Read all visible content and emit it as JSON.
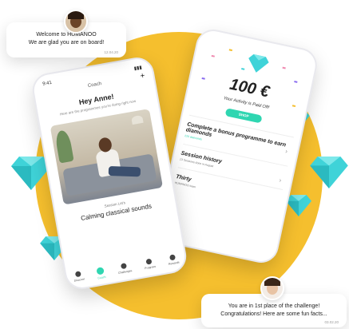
{
  "bubble_top": {
    "title": "Welcome to HUMANOO",
    "text": "We are glad you are on board!",
    "date": "12.04.20"
  },
  "bubble_bottom": {
    "title": "You are in 1st place of the challenge!",
    "text": "Congratulations! Here are some fun facts...",
    "date": "03.02.20"
  },
  "phone_left": {
    "status_time": "9:41",
    "header_title": "Coach",
    "add_label": "+",
    "greeting": "Hey Anne!",
    "subtitle": "Here are the programmes you're doing right now",
    "session_label": "Session Let's",
    "session_title": "Calming classical sounds",
    "nav": [
      "Discover",
      "Coach",
      "Challenges",
      "Progress",
      "Rewards"
    ]
  },
  "phone_right": {
    "amount": "100 €",
    "paid_text": "Your Activity is Paid Off!",
    "shop_label": "SHOP",
    "cards": [
      {
        "title": "Complete a bonus programme to earn diamonds",
        "sub": "220 diamonds"
      },
      {
        "title": "Session history",
        "sub": "13 Sessions done in August"
      },
      {
        "title": "Thirty",
        "sub": "HUMANOO team"
      }
    ]
  },
  "colors": {
    "accent": "#2fd6b1",
    "circle": "#f5bf2e",
    "diamond": "#3fd3d8"
  },
  "icons": [
    "diamond-icon",
    "plus-icon",
    "chevron-right-icon"
  ]
}
